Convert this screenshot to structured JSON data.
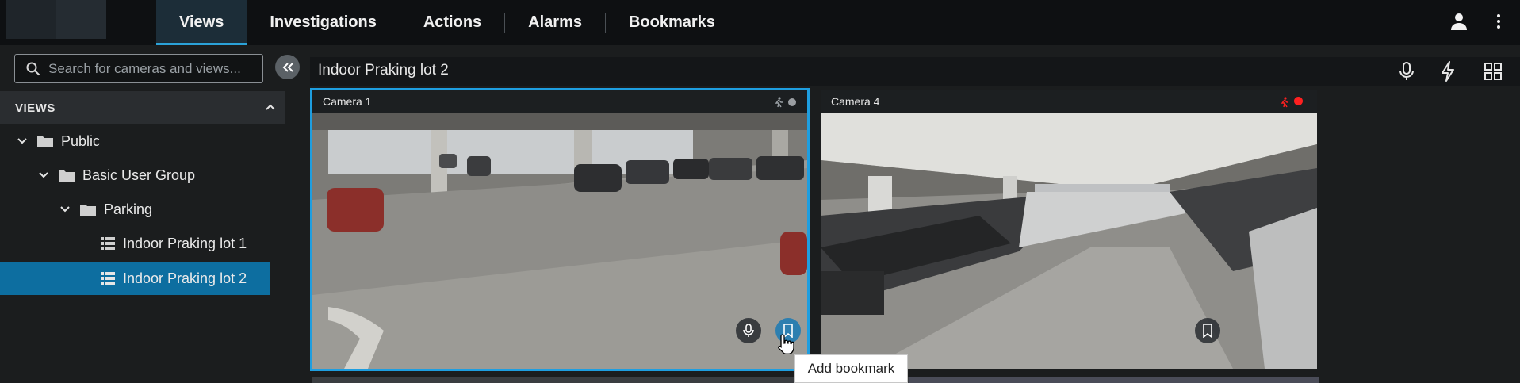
{
  "topbar": {
    "tabs": [
      {
        "label": "Views",
        "active": true
      },
      {
        "label": "Investigations",
        "active": false
      },
      {
        "label": "Actions",
        "active": false
      },
      {
        "label": "Alarms",
        "active": false
      },
      {
        "label": "Bookmarks",
        "active": false
      }
    ],
    "icons": [
      "user-icon",
      "more-vertical-icon"
    ]
  },
  "sidebar": {
    "search": {
      "placeholder": "Search for cameras and views..."
    },
    "section_label": "VIEWS",
    "tree": [
      {
        "label": "Public",
        "type": "folder",
        "expanded": true
      },
      {
        "label": "Basic User Group",
        "type": "folder",
        "expanded": true
      },
      {
        "label": "Parking",
        "type": "folder",
        "expanded": true
      },
      {
        "label": "Indoor Praking lot 1",
        "type": "view",
        "selected": false
      },
      {
        "label": "Indoor Praking lot 2",
        "type": "view",
        "selected": true
      }
    ]
  },
  "main": {
    "title": "Indoor Praking lot 2",
    "toolbar_icons": [
      "microphone-icon",
      "lightning-icon",
      "grid-layout-icon"
    ],
    "tiles": [
      {
        "camera": "Camera 1",
        "selected": true,
        "recording": false
      },
      {
        "camera": "Camera 4",
        "selected": false,
        "recording": true
      }
    ],
    "tooltip": "Add bookmark"
  },
  "colors": {
    "accent": "#2ba2d8",
    "selected_row": "#0d6ea0",
    "recording": "#ff2020"
  }
}
